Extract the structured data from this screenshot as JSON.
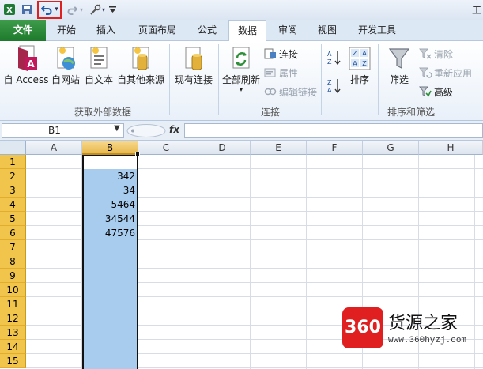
{
  "qat": {
    "undo_arrow": "▾",
    "title_char": "工"
  },
  "tabs": [
    {
      "label": "文件"
    },
    {
      "label": "开始"
    },
    {
      "label": "插入"
    },
    {
      "label": "页面布局"
    },
    {
      "label": "公式"
    },
    {
      "label": "数据"
    },
    {
      "label": "审阅"
    },
    {
      "label": "视图"
    },
    {
      "label": "开发工具"
    }
  ],
  "ribbon": {
    "get_external": {
      "access": "自 Access",
      "web": "自网站",
      "text": "自文本",
      "other": "自其他来源",
      "existing": "现有连接",
      "group_label": "获取外部数据"
    },
    "connections": {
      "refresh_all": "全部刷新",
      "refresh_arrow": "▾",
      "connections": "连接",
      "properties": "属性",
      "edit_links": "编辑链接",
      "group_label": "连接"
    },
    "sort_filter": {
      "sort": "排序",
      "filter": "筛选",
      "clear": "清除",
      "reapply": "重新应用",
      "advanced": "高级",
      "group_label": "排序和筛选"
    }
  },
  "formula_bar": {
    "name_box": "B1",
    "fx_label": "fx",
    "formula": ""
  },
  "grid": {
    "columns": [
      "A",
      "B",
      "C",
      "D",
      "E",
      "F",
      "G",
      "H"
    ],
    "rows": [
      "1",
      "2",
      "3",
      "4",
      "5",
      "6",
      "7",
      "8",
      "9",
      "10",
      "11",
      "12",
      "13",
      "14",
      "15"
    ],
    "b_values": [
      "",
      "342",
      "34",
      "5464",
      "34544",
      "47576"
    ]
  },
  "watermark": {
    "badge": "360",
    "name": "货源之家",
    "url": "www.360hyzj.com"
  },
  "colors": {
    "file_tab": "#2a8a3a",
    "selection": "#a8ccee",
    "row_header": "#f1c44b",
    "watermark_red": "#e02020"
  }
}
